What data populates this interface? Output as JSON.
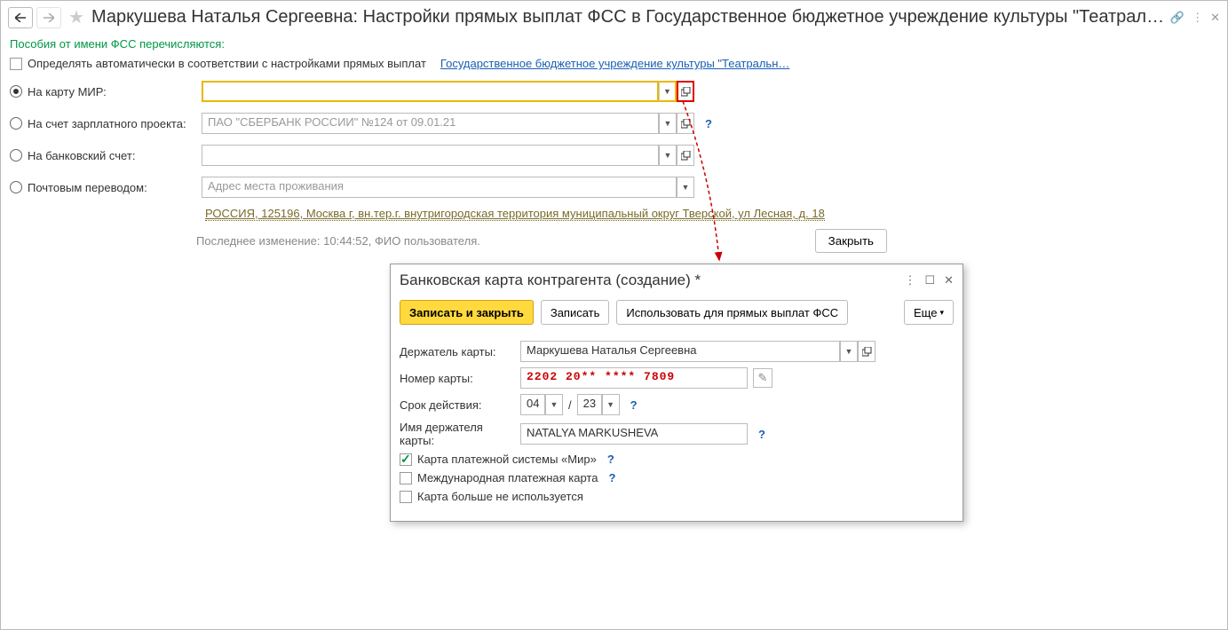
{
  "header": {
    "title": "Маркушева Наталья Сергеевна: Настройки прямых выплат ФСС в Государственное бюджетное учреждение культуры \"Театраль…"
  },
  "section_label": "Пособия от имени ФСС перечисляются:",
  "auto_checkbox_label": "Определять автоматически в соответствии с настройками прямых выплат",
  "org_link": "Государственное бюджетное учреждение культуры \"Театральн…",
  "radios": {
    "mir": "На карту МИР:",
    "salary": "На счет зарплатного проекта:",
    "bank": "На банковский счет:",
    "postal": "Почтовым переводом:"
  },
  "fields": {
    "mir_value": "",
    "salary_value": "ПАО \"СБЕРБАНК РОССИИ\" №124 от 09.01.21",
    "bank_value": "",
    "postal_placeholder": "Адрес места проживания"
  },
  "address": "РОССИЯ, 125196, Москва г, вн.тер.г. внутригородская территория муниципальный округ Тверской, ул Лесная, д. 18",
  "last_change": "Последнее изменение: 10:44:52, ФИО пользователя.",
  "close_button": "Закрыть",
  "modal": {
    "title": "Банковская карта контрагента (создание) *",
    "save_close": "Записать и закрыть",
    "save": "Записать",
    "use_fss": "Использовать для прямых выплат ФСС",
    "more": "Еще",
    "holder_label": "Держатель карты:",
    "holder_value": "Маркушева Наталья Сергеевна",
    "number_label": "Номер карты:",
    "number_value": "2202 20** **** 7809",
    "expiry_label": "Срок действия:",
    "expiry_month": "04",
    "expiry_year": "23",
    "name_label": "Имя держателя карты:",
    "name_value": "NATALYA MARKUSHEVA",
    "mir_checkbox": "Карта платежной системы «Мир»",
    "intl_checkbox": "Международная платежная карта",
    "unused_checkbox": "Карта больше не используется"
  }
}
